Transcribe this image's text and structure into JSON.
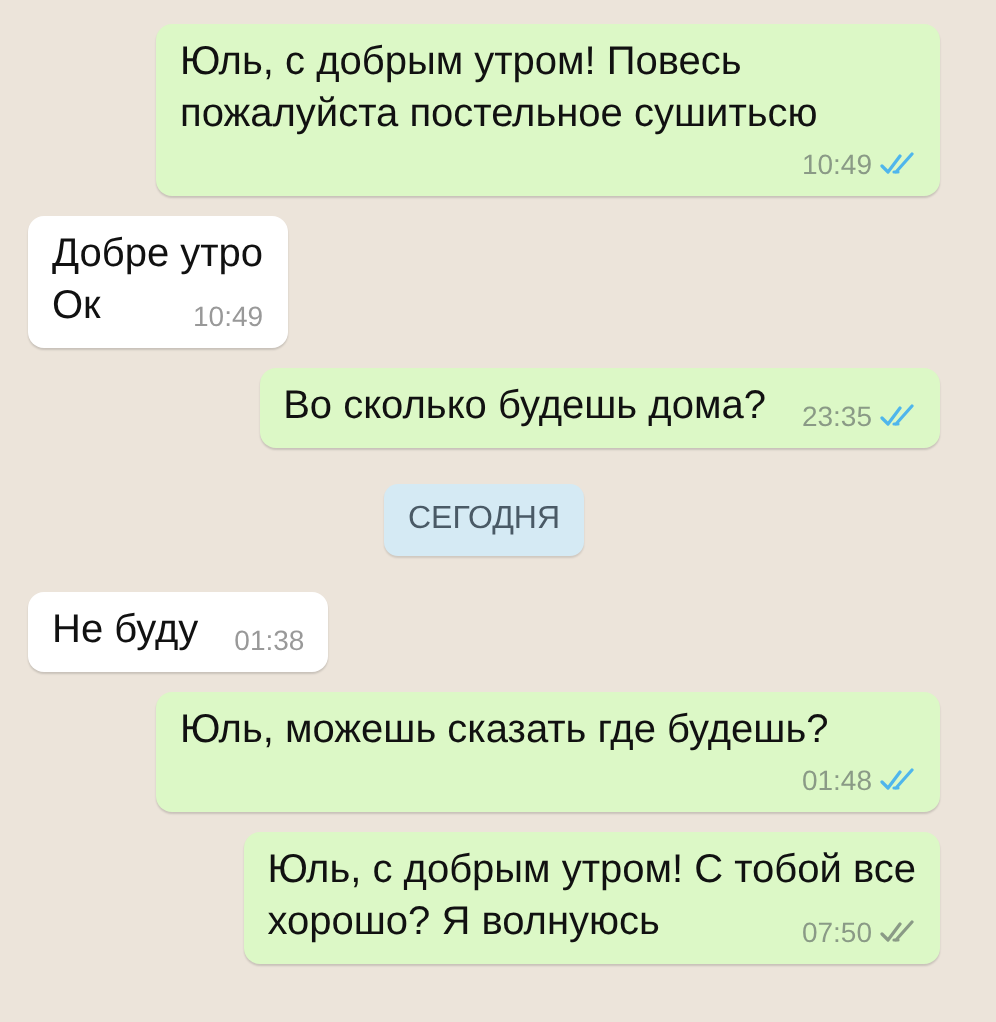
{
  "messages": [
    {
      "kind": "outgoing",
      "lines": [
        "Юль, с добрым утром! Повесь",
        "пожалуйста постельное сушитьсю"
      ],
      "time": "10:49",
      "read": true
    },
    {
      "kind": "incoming",
      "lines": [
        "Добре утро",
        "Ок"
      ],
      "time": "10:49"
    },
    {
      "kind": "outgoing",
      "lines": [
        "Во сколько будешь дома?"
      ],
      "time": "23:35",
      "read": true
    },
    {
      "kind": "date",
      "text": "СЕГОДНЯ"
    },
    {
      "kind": "incoming",
      "lines": [
        "Не буду"
      ],
      "time": "01:38"
    },
    {
      "kind": "outgoing",
      "lines": [
        "Юль, можешь сказать где будешь?"
      ],
      "time": "01:48",
      "read": true
    },
    {
      "kind": "outgoing",
      "lines": [
        "Юль, с добрым утром! С тобой все",
        "хорошо? Я волнуюсь"
      ],
      "time": "07:50",
      "read": false
    }
  ]
}
